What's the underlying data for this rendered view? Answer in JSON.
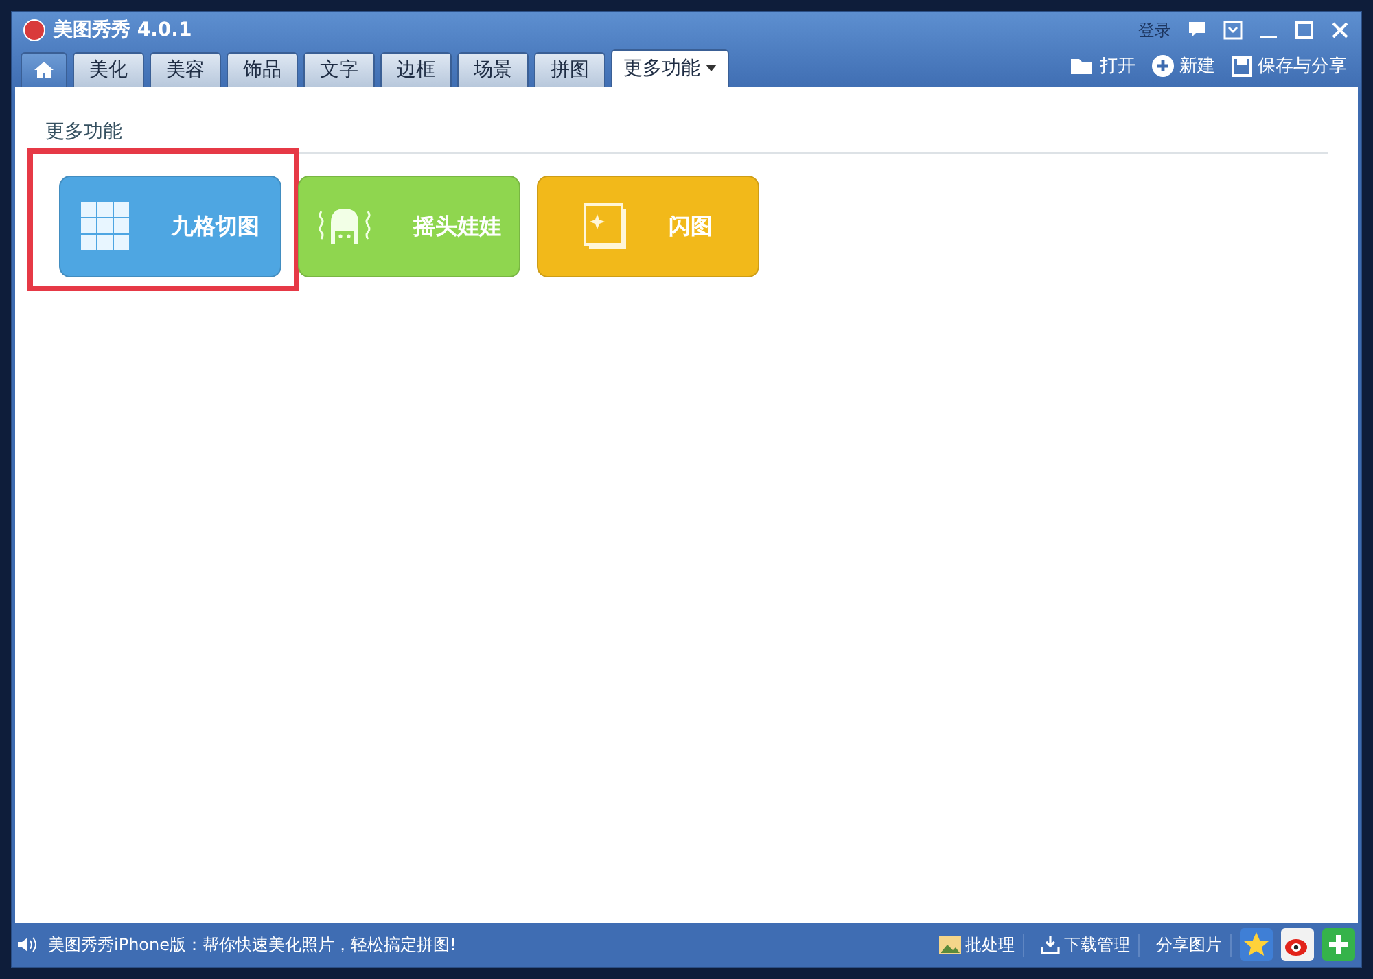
{
  "window": {
    "title": "美图秀秀 4.0.1",
    "login": "登录"
  },
  "tabs": [
    {
      "kind": "home",
      "selected": false
    },
    {
      "label": "美化",
      "kind": "text",
      "selected": false
    },
    {
      "label": "美容",
      "kind": "text",
      "selected": false
    },
    {
      "label": "饰品",
      "kind": "text",
      "selected": false
    },
    {
      "label": "文字",
      "kind": "text",
      "selected": false
    },
    {
      "label": "边框",
      "kind": "text",
      "selected": false
    },
    {
      "label": "场景",
      "kind": "text",
      "selected": false
    },
    {
      "label": "拼图",
      "kind": "text",
      "selected": false
    },
    {
      "label": "更多功能",
      "kind": "menu",
      "selected": true
    }
  ],
  "toolbar": [
    {
      "label": "打开",
      "kind": "open"
    },
    {
      "label": "新建",
      "kind": "new"
    },
    {
      "label": "保存与分享",
      "kind": "save"
    }
  ],
  "section_title": "更多功能",
  "features": [
    {
      "label": "九格切图",
      "kind": "grid",
      "color": "#4ea6e2",
      "highlighted": true
    },
    {
      "label": "摇头娃娃",
      "kind": "doll",
      "color": "#8fd64f",
      "highlighted": false
    },
    {
      "label": "闪图",
      "kind": "flash",
      "color": "#f2b91a",
      "highlighted": false
    }
  ],
  "status_bar": {
    "message": "美图秀秀iPhone版：帮你快速美化照片，轻松搞定拼图!",
    "actions": [
      {
        "label": "批处理",
        "kind": "batch"
      },
      {
        "label": "下载管理",
        "kind": "download"
      },
      {
        "label": "分享图片",
        "kind": "share"
      }
    ]
  }
}
